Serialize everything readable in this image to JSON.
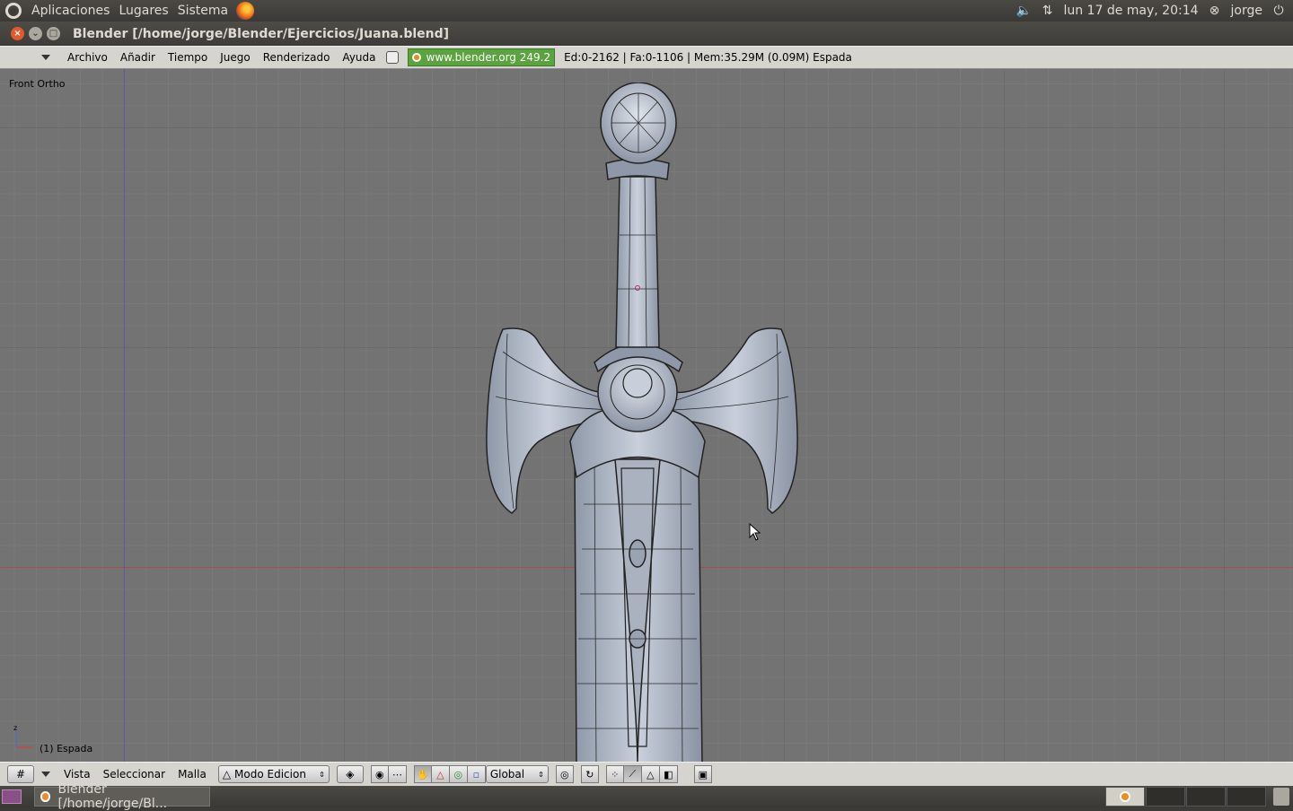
{
  "top_panel": {
    "menus": [
      "Aplicaciones",
      "Lugares",
      "Sistema"
    ],
    "clock": "lun 17 de may, 20:14",
    "user": "jorge",
    "icons": [
      "ubuntu-logo-icon",
      "firefox-icon",
      "volume-icon",
      "network-icon",
      "user-status-icon",
      "power-icon"
    ]
  },
  "window": {
    "title": "Blender [/home/jorge/Blender/Ejercicios/Juana.blend]"
  },
  "info_header": {
    "menus": [
      "Archivo",
      "Añadir",
      "Tiempo",
      "Juego",
      "Renderizado",
      "Ayuda"
    ],
    "url_button": "www.blender.org 249.2",
    "stats": "Ed:0-2162 | Fa:0-1106 | Mem:35.29M (0.09M) Espada"
  },
  "viewport": {
    "view_label": "Front Ortho",
    "object_label": "(1) Espada",
    "gizmo_axis_label": "z"
  },
  "view_header": {
    "menus": [
      "Vista",
      "Seleccionar",
      "Malla"
    ],
    "mode": "Modo Edicion",
    "orientation": "Global"
  },
  "taskbar": {
    "task_label": "Blender [/home/jorge/Bl..."
  },
  "colors": {
    "viewport_bg": "#737373",
    "x_axis": "#a0504a",
    "z_axis": "#5a5a9a",
    "blender_url_bg": "#5aa33e"
  }
}
